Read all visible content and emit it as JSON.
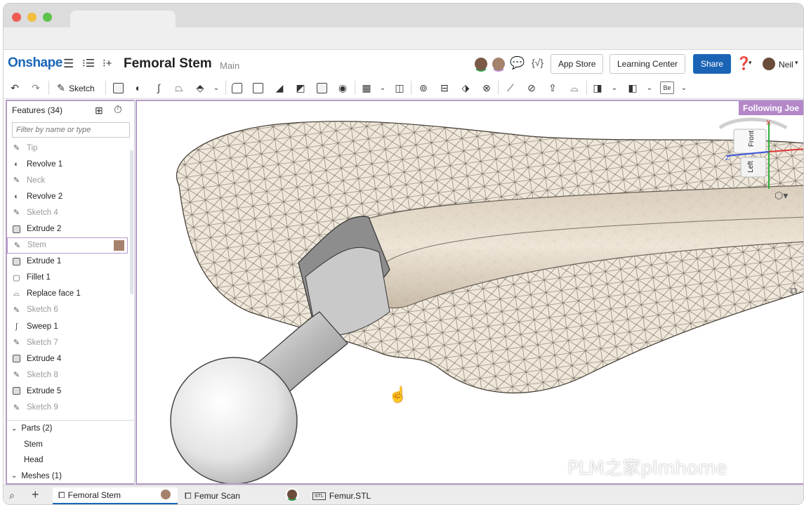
{
  "colors": {
    "accent": "#1b64b5",
    "follow": "#b387c8",
    "brand": "#1a66b8"
  },
  "header": {
    "logo": "Onshape",
    "title": "Femoral Stem",
    "branch": "Main",
    "app_store": "App Store",
    "learning_center": "Learning Center",
    "share": "Share",
    "user": "Neil",
    "icons": [
      "menu-icon",
      "feature-tree-icon",
      "insert-icon",
      "chat-icon",
      "variables-icon",
      "help-icon"
    ]
  },
  "toolbar": {
    "sketch_label": "Sketch",
    "bead_label": "Be"
  },
  "features": {
    "title": "Features (34)",
    "filter_placeholder": "Filter by name or type",
    "items": [
      {
        "label": "Tip",
        "icon": "sketch-icon",
        "dim": true
      },
      {
        "label": "Revolve 1",
        "icon": "revolve-icon",
        "dim": false
      },
      {
        "label": "Neck",
        "icon": "sketch-icon",
        "dim": true
      },
      {
        "label": "Revolve 2",
        "icon": "revolve-icon",
        "dim": false
      },
      {
        "label": "Sketch 4",
        "icon": "sketch-icon",
        "dim": true
      },
      {
        "label": "Extrude 2",
        "icon": "extrude-icon",
        "dim": false
      },
      {
        "label": "Stem",
        "icon": "sketch-icon",
        "dim": true
      },
      {
        "label": "Extrude 1",
        "icon": "extrude-icon",
        "dim": false
      },
      {
        "label": "Fillet 1",
        "icon": "fillet-icon",
        "dim": false
      },
      {
        "label": "Replace face 1",
        "icon": "replace-face-icon",
        "dim": false
      },
      {
        "label": "Sketch 6",
        "icon": "sketch-icon",
        "dim": true
      },
      {
        "label": "Sweep 1",
        "icon": "sweep-icon",
        "dim": false
      },
      {
        "label": "Sketch 7",
        "icon": "sketch-icon",
        "dim": true
      },
      {
        "label": "Extrude 4",
        "icon": "extrude-icon",
        "dim": false
      },
      {
        "label": "Sketch 8",
        "icon": "sketch-icon",
        "dim": true
      },
      {
        "label": "Extrude 5",
        "icon": "extrude-icon",
        "dim": false
      },
      {
        "label": "Sketch 9",
        "icon": "sketch-icon",
        "dim": true
      }
    ],
    "parts_label": "Parts (2)",
    "parts": [
      "Stem",
      "Head"
    ],
    "meshes_label": "Meshes (1)"
  },
  "viewport": {
    "following": "Following Joe",
    "cube_front": "Front",
    "cube_left": "Left",
    "axis_x": "X",
    "axis_z": "Z"
  },
  "tabs": {
    "items": [
      "Femoral Stem",
      "Femur Scan",
      "Femur.STL"
    ],
    "stl_badge": "STL"
  },
  "watermark": "PLM之家plmhome"
}
